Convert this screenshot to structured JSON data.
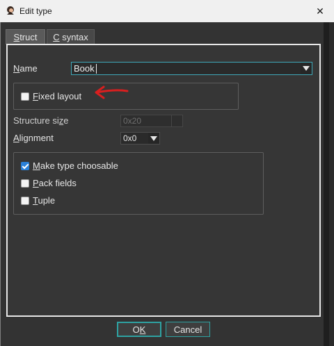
{
  "window": {
    "title": "Edit type",
    "close_glyph": "✕"
  },
  "tabs": [
    {
      "mnemonic": "S",
      "rest": "truct",
      "active": true
    },
    {
      "mnemonic": "C",
      "rest": " syntax",
      "active": false
    }
  ],
  "name": {
    "mnemonic": "N",
    "label_rest": "ame",
    "value": "Book"
  },
  "fixed_layout": {
    "mnemonic": "F",
    "label_rest": "ixed layout",
    "checked": false
  },
  "structure_size": {
    "label_start": "Structure si",
    "mnemonic": "z",
    "label_end": "e",
    "value": "0x20"
  },
  "alignment": {
    "mnemonic": "A",
    "label_rest": "lignment",
    "value": "0x0"
  },
  "options": [
    {
      "mnemonic": "M",
      "rest": "ake type choosable",
      "checked": true
    },
    {
      "mnemonic": "P",
      "rest": "ack fields",
      "checked": false
    },
    {
      "mnemonic": "T",
      "rest": "uple",
      "checked": false
    }
  ],
  "buttons": {
    "ok_start": "O",
    "ok_mnemonic": "K",
    "cancel": "Cancel"
  },
  "colors": {
    "accent": "#2ea3a3",
    "focus": "#3fa9b9",
    "annotation": "#d91f1f",
    "check": "#2a80d8"
  }
}
